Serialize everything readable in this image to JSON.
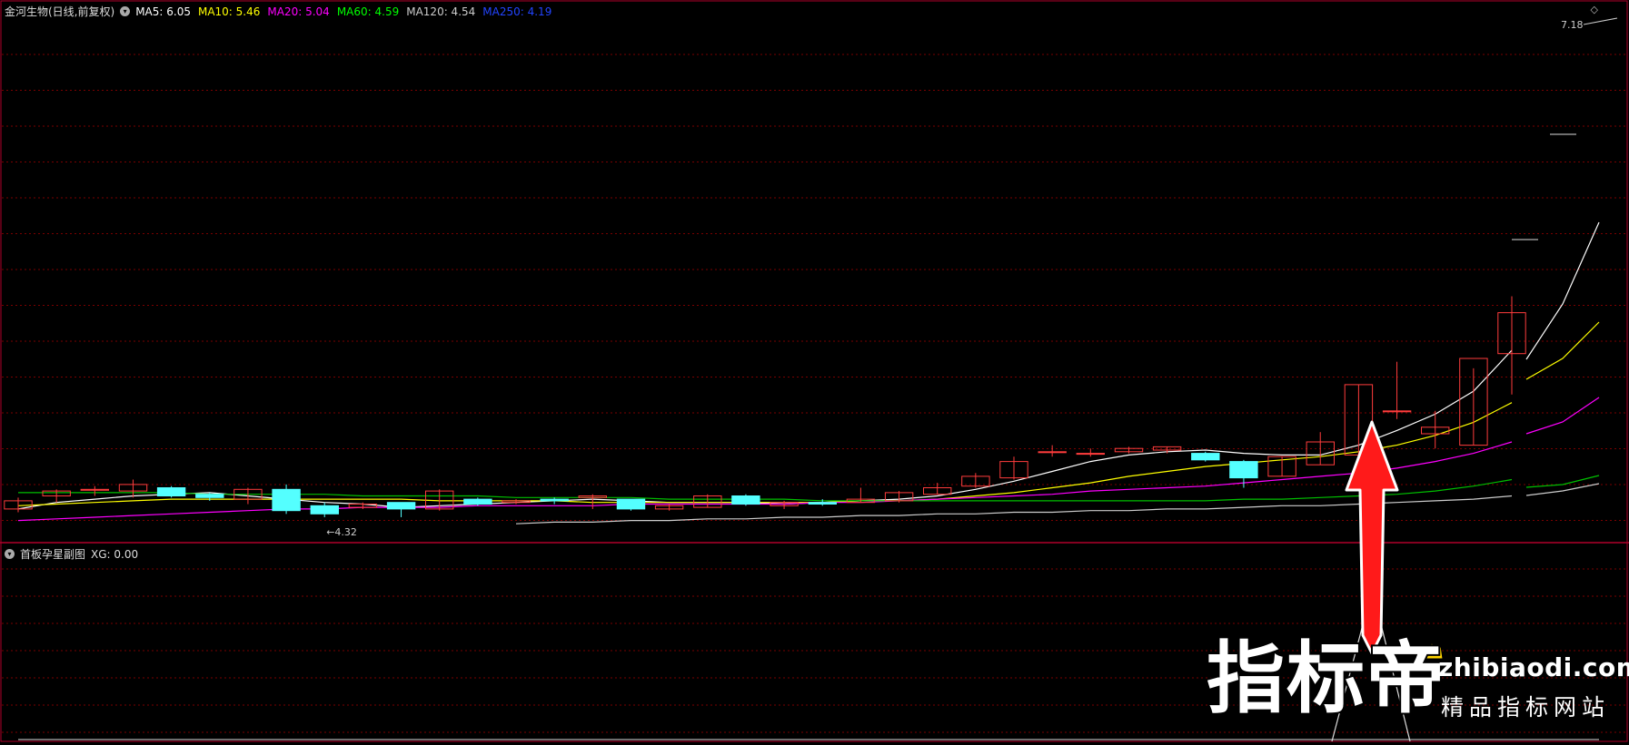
{
  "main_panel": {
    "stock_name": "金河生物(日线,前复权)",
    "ma_legend": [
      {
        "label": "MA5: 6.05",
        "color": "#ffffff"
      },
      {
        "label": "MA10: 5.46",
        "color": "#ffff00"
      },
      {
        "label": "MA20: 5.04",
        "color": "#ff00ff"
      },
      {
        "label": "MA60: 4.59",
        "color": "#00ff00"
      },
      {
        "label": "MA120: 4.54",
        "color": "#cccccc"
      },
      {
        "label": "MA250: 4.19",
        "color": "#2244ff"
      }
    ],
    "high_label": "7.18",
    "low_label": "4.32"
  },
  "sub_panel": {
    "title": "首板孕星副图",
    "value": "XG: 0.00"
  },
  "watermark": {
    "brand": "指标帝",
    "url": "zhibiaodi.com",
    "tagline": "精品指标网站"
  },
  "colors": {
    "up": "#ff3c3c",
    "down": "#54ffff",
    "grid": "#7a0000",
    "border": "#b0002a"
  },
  "chart_data": {
    "type": "candlestick",
    "series": [
      {
        "name": "K",
        "ohlc": [
          [
            4.4,
            4.47,
            4.38,
            4.45
          ],
          [
            4.48,
            4.52,
            4.44,
            4.51
          ],
          [
            4.52,
            4.54,
            4.48,
            4.52
          ],
          [
            4.51,
            4.58,
            4.47,
            4.55
          ],
          [
            4.53,
            4.54,
            4.47,
            4.48
          ],
          [
            4.49,
            4.5,
            4.45,
            4.47
          ],
          [
            4.46,
            4.53,
            4.43,
            4.52
          ],
          [
            4.52,
            4.55,
            4.37,
            4.39
          ],
          [
            4.42,
            4.44,
            4.35,
            4.37
          ],
          [
            4.41,
            4.44,
            4.4,
            4.43
          ],
          [
            4.44,
            4.44,
            4.35,
            4.4
          ],
          [
            4.4,
            4.52,
            4.39,
            4.51
          ],
          [
            4.46,
            4.47,
            4.42,
            4.43
          ],
          [
            4.44,
            4.46,
            4.43,
            4.45
          ],
          [
            4.46,
            4.47,
            4.43,
            4.45
          ],
          [
            4.47,
            4.49,
            4.4,
            4.48
          ],
          [
            4.46,
            4.46,
            4.39,
            4.4
          ],
          [
            4.4,
            4.43,
            4.39,
            4.42
          ],
          [
            4.41,
            4.49,
            4.41,
            4.48
          ],
          [
            4.48,
            4.49,
            4.42,
            4.43
          ],
          [
            4.42,
            4.45,
            4.4,
            4.44
          ],
          [
            4.44,
            4.46,
            4.42,
            4.43
          ],
          [
            4.44,
            4.53,
            4.44,
            4.46
          ],
          [
            4.45,
            4.51,
            4.44,
            4.5
          ],
          [
            4.49,
            4.56,
            4.49,
            4.53
          ],
          [
            4.54,
            4.62,
            4.53,
            4.6
          ],
          [
            4.59,
            4.72,
            4.58,
            4.69
          ],
          [
            4.75,
            4.79,
            4.72,
            4.75
          ],
          [
            4.74,
            4.77,
            4.72,
            4.74
          ],
          [
            4.75,
            4.78,
            4.74,
            4.77
          ],
          [
            4.76,
            4.78,
            4.74,
            4.78
          ],
          [
            4.74,
            4.75,
            4.69,
            4.7
          ],
          [
            4.69,
            4.7,
            4.53,
            4.59
          ],
          [
            4.6,
            4.72,
            4.6,
            4.72
          ],
          [
            4.67,
            4.87,
            4.67,
            4.81
          ],
          [
            4.73,
            5.16,
            4.73,
            5.16
          ],
          [
            5.0,
            5.3,
            4.95,
            5.0
          ],
          [
            4.86,
            5.0,
            4.77,
            4.9
          ],
          [
            4.79,
            5.26,
            4.79,
            5.32
          ],
          [
            5.35,
            5.7,
            5.1,
            5.6
          ]
        ]
      },
      {
        "name": "MA5",
        "values": [
          4.4,
          4.44,
          4.46,
          4.48,
          4.49,
          4.5,
          4.48,
          4.46,
          4.44,
          4.43,
          4.41,
          4.42,
          4.43,
          4.44,
          4.45,
          4.46,
          4.45,
          4.44,
          4.44,
          4.44,
          4.43,
          4.44,
          4.45,
          4.46,
          4.48,
          4.52,
          4.57,
          4.63,
          4.69,
          4.73,
          4.75,
          4.76,
          4.74,
          4.73,
          4.73,
          4.79,
          4.88,
          4.98,
          5.12,
          5.37
        ]
      },
      {
        "name": "MA10",
        "values": [
          4.42,
          4.43,
          4.44,
          4.45,
          4.46,
          4.46,
          4.46,
          4.46,
          4.46,
          4.46,
          4.46,
          4.45,
          4.45,
          4.45,
          4.45,
          4.44,
          4.44,
          4.44,
          4.44,
          4.44,
          4.44,
          4.44,
          4.45,
          4.45,
          4.46,
          4.48,
          4.5,
          4.53,
          4.56,
          4.6,
          4.63,
          4.66,
          4.68,
          4.7,
          4.72,
          4.75,
          4.79,
          4.85,
          4.93,
          5.05
        ]
      },
      {
        "name": "MA20",
        "values": [
          4.33,
          4.34,
          4.35,
          4.36,
          4.37,
          4.38,
          4.39,
          4.4,
          4.4,
          4.41,
          4.41,
          4.41,
          4.42,
          4.42,
          4.42,
          4.42,
          4.43,
          4.43,
          4.43,
          4.43,
          4.43,
          4.44,
          4.44,
          4.45,
          4.46,
          4.47,
          4.48,
          4.49,
          4.51,
          4.52,
          4.53,
          4.54,
          4.56,
          4.58,
          4.6,
          4.62,
          4.65,
          4.69,
          4.74,
          4.81
        ]
      },
      {
        "name": "MA60",
        "values": [
          4.5,
          4.5,
          4.5,
          4.5,
          4.5,
          4.49,
          4.49,
          4.49,
          4.49,
          4.48,
          4.48,
          4.48,
          4.48,
          4.47,
          4.47,
          4.47,
          4.47,
          4.46,
          4.46,
          4.46,
          4.46,
          4.45,
          4.45,
          4.45,
          4.45,
          4.45,
          4.45,
          4.45,
          4.45,
          4.45,
          4.45,
          4.45,
          4.46,
          4.46,
          4.47,
          4.48,
          4.49,
          4.51,
          4.54,
          4.58
        ]
      },
      {
        "name": "MA120",
        "values": [
          null,
          null,
          null,
          null,
          null,
          null,
          null,
          null,
          null,
          null,
          null,
          null,
          null,
          4.31,
          4.32,
          4.32,
          4.33,
          4.33,
          4.34,
          4.34,
          4.35,
          4.35,
          4.36,
          4.36,
          4.37,
          4.37,
          4.38,
          4.38,
          4.39,
          4.39,
          4.4,
          4.4,
          4.41,
          4.42,
          4.42,
          4.43,
          4.44,
          4.45,
          4.46,
          4.48
        ]
      }
    ],
    "ylim": [
      4.2,
      7.4
    ],
    "grid": true
  }
}
